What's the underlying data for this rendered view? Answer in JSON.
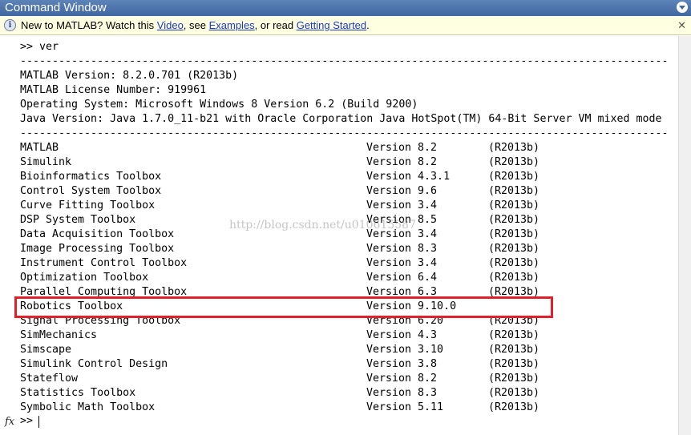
{
  "window": {
    "title": "Command Window"
  },
  "info_bar": {
    "prefix": "New to MATLAB? Watch this ",
    "link_video": "Video",
    "sep1": ", see ",
    "link_examples": "Examples",
    "sep2": ", or read ",
    "link_getting_started": "Getting Started",
    "suffix": "."
  },
  "console": {
    "command": ">> ver",
    "separator": "-----------------------------------------------------------------------------------------------------",
    "header_lines": [
      "MATLAB Version: 8.2.0.701 (R2013b)",
      "MATLAB License Number: 919961",
      "Operating System: Microsoft Windows 8 Version 6.2 (Build 9200)",
      "Java Version: Java 1.7.0_11-b21 with Oracle Corporation Java HotSpot(TM) 64-Bit Server VM mixed mode"
    ],
    "toolboxes": [
      {
        "name": "MATLAB",
        "version": "Version 8.2",
        "release": "(R2013b)"
      },
      {
        "name": "Simulink",
        "version": "Version 8.2",
        "release": "(R2013b)"
      },
      {
        "name": "Bioinformatics Toolbox",
        "version": "Version 4.3.1",
        "release": "(R2013b)"
      },
      {
        "name": "Control System Toolbox",
        "version": "Version 9.6",
        "release": "(R2013b)"
      },
      {
        "name": "Curve Fitting Toolbox",
        "version": "Version 3.4",
        "release": "(R2013b)"
      },
      {
        "name": "DSP System Toolbox",
        "version": "Version 8.5",
        "release": "(R2013b)"
      },
      {
        "name": "Data Acquisition Toolbox",
        "version": "Version 3.4",
        "release": "(R2013b)"
      },
      {
        "name": "Image Processing Toolbox",
        "version": "Version 8.3",
        "release": "(R2013b)"
      },
      {
        "name": "Instrument Control Toolbox",
        "version": "Version 3.4",
        "release": "(R2013b)"
      },
      {
        "name": "Optimization Toolbox",
        "version": "Version 6.4",
        "release": "(R2013b)"
      },
      {
        "name": "Parallel Computing Toolbox",
        "version": "Version 6.3",
        "release": "(R2013b)"
      },
      {
        "name": "Robotics Toolbox",
        "version": "Version 9.10.0",
        "release": ""
      },
      {
        "name": "Signal Processing Toolbox",
        "version": "Version 6.20",
        "release": "(R2013b)"
      },
      {
        "name": "SimMechanics",
        "version": "Version 4.3",
        "release": "(R2013b)"
      },
      {
        "name": "Simscape",
        "version": "Version 3.10",
        "release": "(R2013b)"
      },
      {
        "name": "Simulink Control Design",
        "version": "Version 3.8",
        "release": "(R2013b)"
      },
      {
        "name": "Stateflow",
        "version": "Version 8.2",
        "release": "(R2013b)"
      },
      {
        "name": "Statistics Toolbox",
        "version": "Version 8.3",
        "release": "(R2013b)"
      },
      {
        "name": "Symbolic Math Toolbox",
        "version": "Version 5.11",
        "release": "(R2013b)"
      }
    ],
    "prompt": ">>"
  },
  "watermark": "http://blog.csdn.net/u010615587",
  "fx_label": "fx",
  "colors": {
    "title_bar": "#4a72aa",
    "info_bar": "#ffffe1",
    "link": "#1a39c8",
    "highlight": "#e0212b"
  },
  "icons": {
    "info": "info-icon",
    "menu": "window-menu-icon",
    "close": "close-icon",
    "fx": "function-browser-icon"
  }
}
